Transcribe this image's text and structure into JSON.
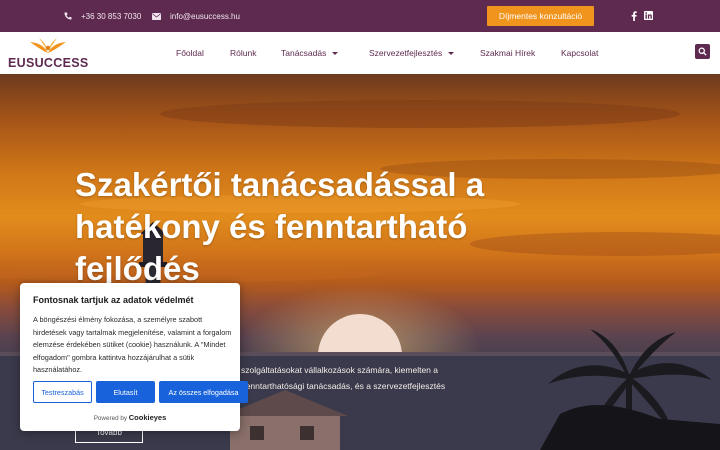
{
  "topbar": {
    "phone": "+36 30 853 7030",
    "email": "info@eusuccess.hu",
    "cta_label": "Díjmentes konzultáció",
    "social_icons": [
      "facebook-icon",
      "linkedin-icon"
    ]
  },
  "header": {
    "logo_text": "EUSUCCESS",
    "nav": [
      {
        "label": "Főoldal"
      },
      {
        "label": "Rólunk"
      },
      {
        "label": "Tanácsadás"
      },
      {
        "label": "Szervezetfejlesztés"
      },
      {
        "label": "Szakmai Hírek"
      },
      {
        "label": "Kapcsolat"
      }
    ]
  },
  "hero": {
    "title": "Szakértői tanácsadással a hatékony és fenntartható fejlődés",
    "desc_line1": "ói szolgáltatásokat vállalkozások számára, kiemelten a",
    "desc_line2": "es fenntarthatósági tanácsadás, és a szervezetfejlesztés",
    "more_label": "Tovább"
  },
  "cookie": {
    "title": "Fontosnak tartjuk az adatok védelmét",
    "text": "A böngészési élmény fokozása, a személyre szabott hirdetések vagy tartalmak megjelenítése, valamint a forgalom elemzése érdekében sütiket (cookie) használunk. A \"Mindet elfogadom\" gombra kattintva hozzájárulhat a sütik használatához.",
    "customize_label": "Testreszabás",
    "reject_label": "Elutasít",
    "accept_label": "Az összes elfogadása",
    "powered_by": "Powered by",
    "powered_brand": "Cookieyes"
  },
  "colors": {
    "brand": "#5e2a50",
    "accent": "#f0941d",
    "cookie_button": "#1863dc"
  }
}
